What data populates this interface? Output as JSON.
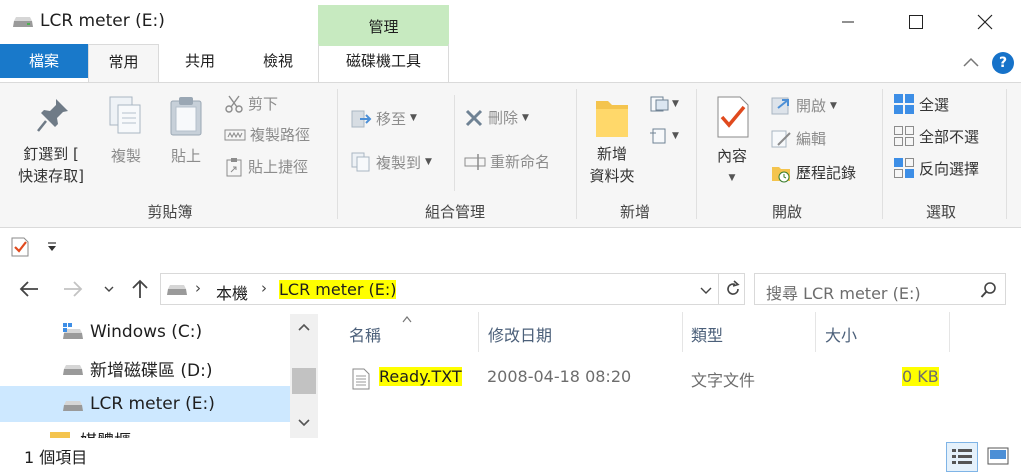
{
  "window": {
    "title": "LCR meter (E:)",
    "minimize_icon": "minimize-icon",
    "maximize_icon": "maximize-icon",
    "close_icon": "close-icon"
  },
  "contextual_tab_header": "管理",
  "tabs": {
    "file": "檔案",
    "home": "常用",
    "share": "共用",
    "view": "檢視",
    "drive_tools": "磁碟機工具"
  },
  "ribbon": {
    "clipboard": {
      "label": "剪貼簿",
      "pin_line1": "釘選到 [",
      "pin_line2": "快速存取]",
      "copy": "複製",
      "paste": "貼上",
      "cut": "剪下",
      "copy_path": "複製路徑",
      "paste_shortcut": "貼上捷徑"
    },
    "organize": {
      "label": "組合管理",
      "move_to": "移至",
      "copy_to": "複製到",
      "delete": "刪除",
      "rename": "重新命名"
    },
    "new": {
      "label": "新增",
      "new_folder_line1": "新增",
      "new_folder_line2": "資料夾"
    },
    "open": {
      "label": "開啟",
      "properties": "內容",
      "open": "開啟",
      "edit": "編輯",
      "history": "歷程記錄"
    },
    "select": {
      "label": "選取",
      "select_all": "全選",
      "select_none": "全部不選",
      "invert": "反向選擇"
    }
  },
  "address_bar": {
    "root": "本機",
    "current": "LCR meter (E:)",
    "separator": "›"
  },
  "search": {
    "placeholder": "搜尋 LCR meter (E:)"
  },
  "sidebar": {
    "items": [
      {
        "label": "Windows (C:)"
      },
      {
        "label": "新增磁碟區 (D:)"
      },
      {
        "label": "LCR meter (E:)"
      },
      {
        "label": "媒體櫃"
      }
    ]
  },
  "columns": {
    "name": "名稱",
    "modified": "修改日期",
    "type": "類型",
    "size": "大小"
  },
  "files": [
    {
      "name": "Ready.TXT",
      "modified": "2008-04-18 08:20",
      "type": "文字文件",
      "size": "0 KB"
    }
  ],
  "status": {
    "count": "1 個項目"
  },
  "colors": {
    "file_tab": "#1979ca",
    "drive_tools_tab": "#c7eac0",
    "highlight": "#ffff00",
    "selected_nav": "#cde8ff"
  }
}
